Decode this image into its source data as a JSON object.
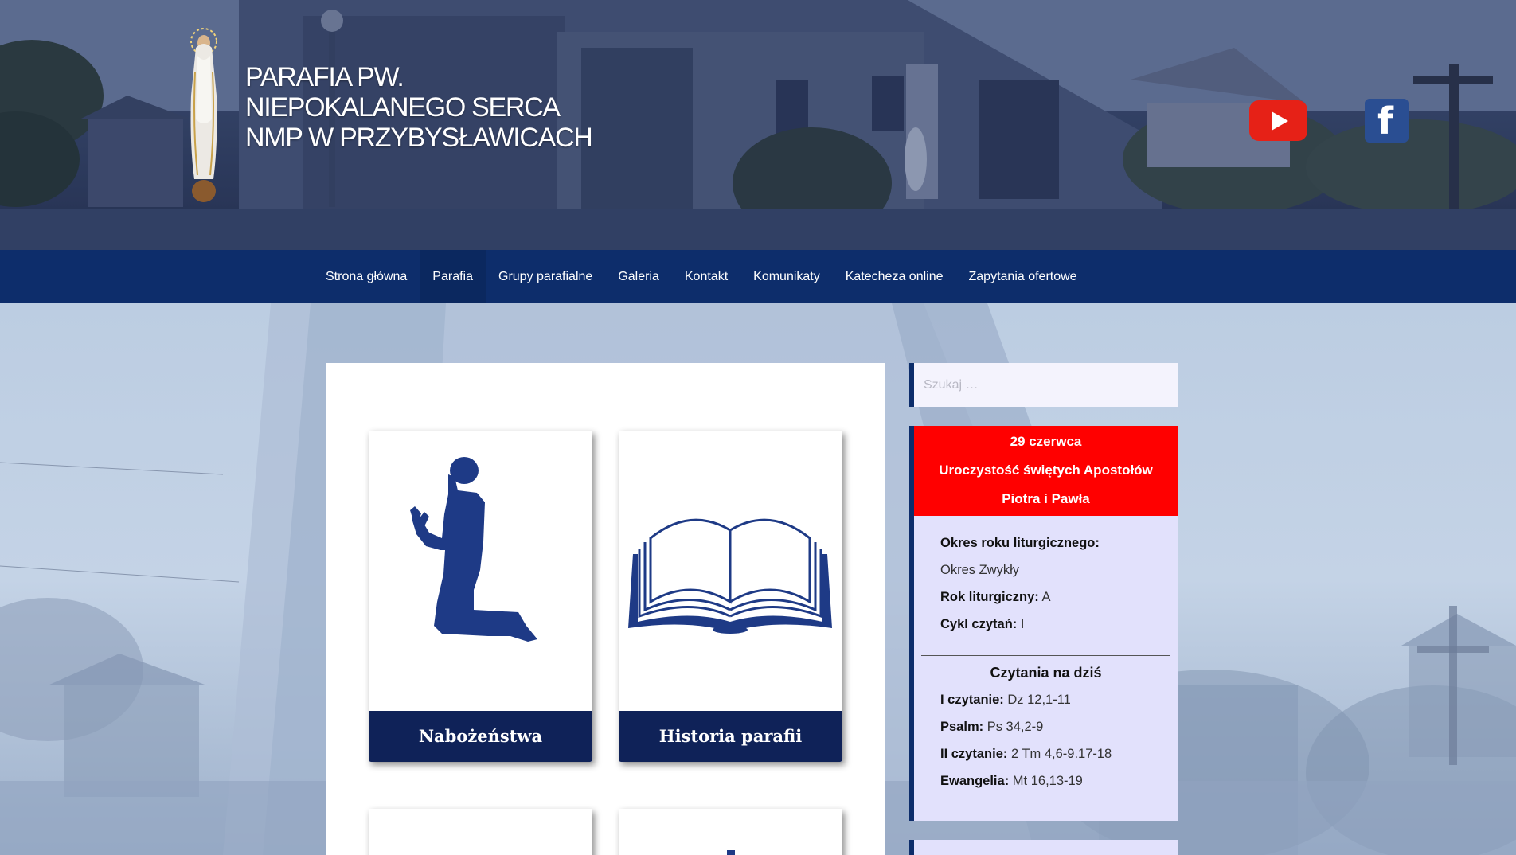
{
  "header": {
    "title_lines": [
      "PARAFIA PW.",
      "NIEPOKALANEGO SERCA",
      "NMP W PRZYBYSŁAWICACH"
    ],
    "social": [
      "youtube-icon",
      "facebook-icon"
    ],
    "facebook_glyph": "f"
  },
  "nav": {
    "items": [
      {
        "label": "Strona główna"
      },
      {
        "label": "Parafia"
      },
      {
        "label": "Grupy parafialne"
      },
      {
        "label": "Galeria"
      },
      {
        "label": "Kontakt"
      },
      {
        "label": "Komunikaty"
      },
      {
        "label": "Katecheza online"
      },
      {
        "label": "Zapytania ofertowe"
      }
    ],
    "active": "Parafia"
  },
  "cards": [
    {
      "label": "Nabożeństwa",
      "icon": "praying-man-icon"
    },
    {
      "label": "Historia parafii",
      "icon": "open-book-icon"
    }
  ],
  "search": {
    "placeholder": "Szukaj …"
  },
  "liturgy": {
    "date": "29 czerwca",
    "feast_line1": "Uroczystość świętych Apostołów",
    "feast_line2": "Piotra i Pawła",
    "period_label": "Okres roku liturgicznego:",
    "period_value": "Okres Zwykły",
    "year_label": "Rok liturgiczny:",
    "year_value": "A",
    "cycle_label": "Cykl czytań:",
    "cycle_value": "I",
    "readings_title": "Czytania na dziś",
    "readings": [
      {
        "label": "I czytanie:",
        "value": "Dz 12,1-11"
      },
      {
        "label": "Psalm:",
        "value": "Ps 34,2-9"
      },
      {
        "label": "II czytanie:",
        "value": "2 Tm 4,6-9.17-18"
      },
      {
        "label": "Ewangelia:",
        "value": "Mt 16,13-19"
      }
    ]
  },
  "colors": {
    "nav_bg": "#0d2d6b",
    "card_label_bg": "#0f2258",
    "feast_red": "#ff0000",
    "sidebar_bg": "#e2e1fc",
    "icon_blue": "#1e3a86"
  }
}
